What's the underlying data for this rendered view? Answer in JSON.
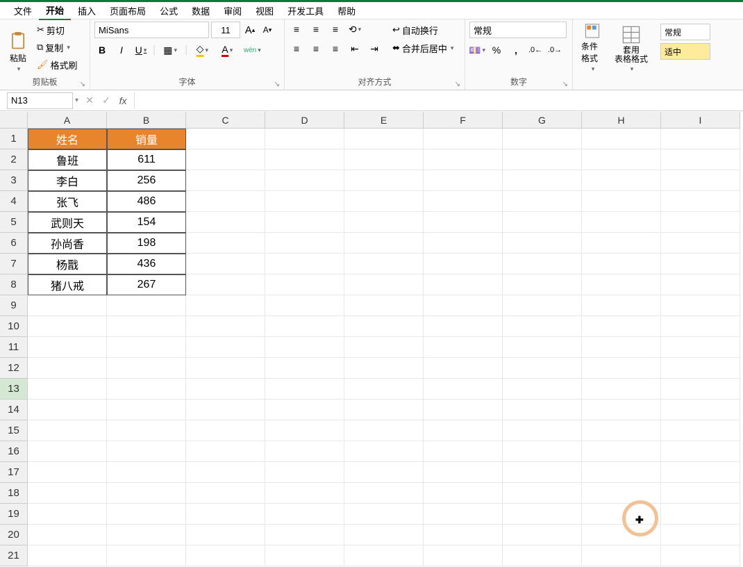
{
  "menu": [
    "文件",
    "开始",
    "插入",
    "页面布局",
    "公式",
    "数据",
    "审阅",
    "视图",
    "开发工具",
    "帮助"
  ],
  "menu_active_index": 1,
  "ribbon": {
    "clipboard": {
      "paste": "粘贴",
      "cut": "剪切",
      "copy": "复制",
      "format_painter": "格式刷",
      "label": "剪贴板"
    },
    "font": {
      "name": "MiSans",
      "size": "11",
      "wen": "wén",
      "label": "字体"
    },
    "align": {
      "wrap": "自动换行",
      "merge": "合并后居中",
      "label": "对齐方式"
    },
    "number": {
      "format": "常规",
      "label": "数字"
    },
    "styles": {
      "cond": "条件格式",
      "table": "套用\n表格格式",
      "normal": "常规",
      "moderate": "适中"
    }
  },
  "formula_bar": {
    "cell_ref": "N13",
    "fx": "fx",
    "value": ""
  },
  "columns": [
    "A",
    "B",
    "C",
    "D",
    "E",
    "F",
    "G",
    "H",
    "I"
  ],
  "rows": [
    1,
    2,
    3,
    4,
    5,
    6,
    7,
    8,
    9,
    10,
    11,
    12,
    13,
    14,
    15,
    16,
    17,
    18,
    19,
    20,
    21
  ],
  "selected_row": 13,
  "table": {
    "headers": [
      "姓名",
      "销量"
    ],
    "data": [
      [
        "鲁班",
        "611"
      ],
      [
        "李白",
        "256"
      ],
      [
        "张飞",
        "486"
      ],
      [
        "武则天",
        "154"
      ],
      [
        "孙尚香",
        "198"
      ],
      [
        "杨戬",
        "436"
      ],
      [
        "猪八戒",
        "267"
      ]
    ]
  },
  "chart_data": {
    "type": "table",
    "title": "",
    "columns": [
      "姓名",
      "销量"
    ],
    "rows": [
      {
        "姓名": "鲁班",
        "销量": 611
      },
      {
        "姓名": "李白",
        "销量": 256
      },
      {
        "姓名": "张飞",
        "销量": 486
      },
      {
        "姓名": "武则天",
        "销量": 154
      },
      {
        "姓名": "孙尚香",
        "销量": 198
      },
      {
        "姓名": "杨戬",
        "销量": 436
      },
      {
        "姓名": "猪八戒",
        "销量": 267
      }
    ]
  }
}
